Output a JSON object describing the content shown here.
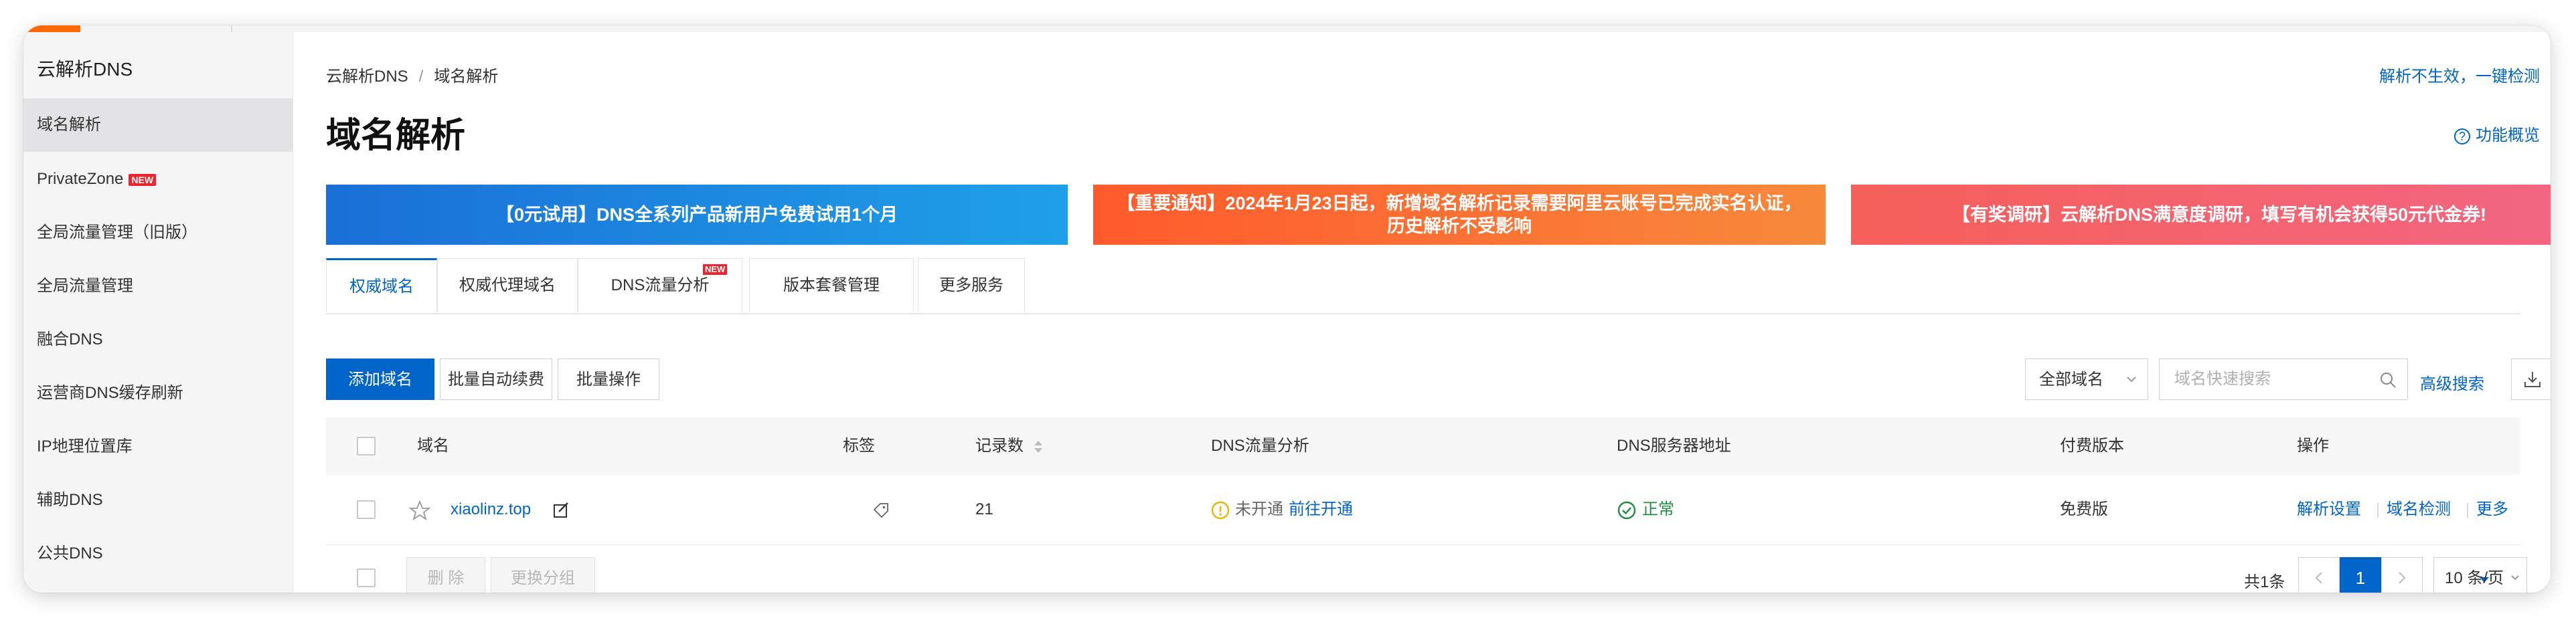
{
  "sidebar": {
    "title": "云解析DNS",
    "items": [
      {
        "label": "域名解析"
      },
      {
        "label": "PrivateZone",
        "badge": "NEW"
      },
      {
        "label": "全局流量管理（旧版）"
      },
      {
        "label": "全局流量管理"
      },
      {
        "label": "融合DNS"
      },
      {
        "label": "运营商DNS缓存刷新"
      },
      {
        "label": "IP地理位置库"
      },
      {
        "label": "辅助DNS"
      },
      {
        "label": "公共DNS"
      }
    ]
  },
  "header": {
    "breadcrumb": [
      "云解析DNS",
      "域名解析"
    ],
    "breadcrumb_sep": "/",
    "check_link": "解析不生效，一键检测",
    "title": "域名解析",
    "overview_link": "功能概览",
    "overview_icon": "?"
  },
  "banners": [
    {
      "text": "【0元试用】DNS全系列产品新用户免费试用1个月"
    },
    {
      "line1": "【重要通知】2024年1月23日起，新增域名解析记录需要阿里云账号已完成实名认证，",
      "line2": "历史解析不受影响"
    },
    {
      "text": "【有奖调研】云解析DNS满意度调研，填写有机会获得50元代金券!"
    }
  ],
  "tabs": [
    {
      "label": "权威域名"
    },
    {
      "label": "权威代理域名"
    },
    {
      "label": "DNS流量分析",
      "badge": "NEW"
    },
    {
      "label": "版本套餐管理"
    },
    {
      "label": "更多服务"
    }
  ],
  "toolbar": {
    "add_domain": "添加域名",
    "batch_renew": "批量自动续费",
    "batch_ops": "批量操作",
    "domain_filter": "全部域名",
    "search_placeholder": "域名快速搜索",
    "advanced_search": "高级搜索"
  },
  "table": {
    "columns": [
      "域名",
      "标签",
      "记录数",
      "DNS流量分析",
      "DNS服务器地址",
      "付费版本",
      "操作"
    ],
    "rows": [
      {
        "domain": "xiaolinz.top",
        "records": "21",
        "traffic_status": "未开通",
        "traffic_action": "前往开通",
        "dns_status": "正常",
        "plan": "免费版",
        "actions": [
          "解析设置",
          "域名检测",
          "更多"
        ]
      }
    ]
  },
  "footer": {
    "delete": "删 除",
    "change_group": "更换分组",
    "total": "共1条",
    "current_page": "1",
    "page_size": "10 条/页"
  },
  "colors": {
    "accent": "#0064c8",
    "ok": "#1e8e3e",
    "warn": "#f0b400"
  }
}
